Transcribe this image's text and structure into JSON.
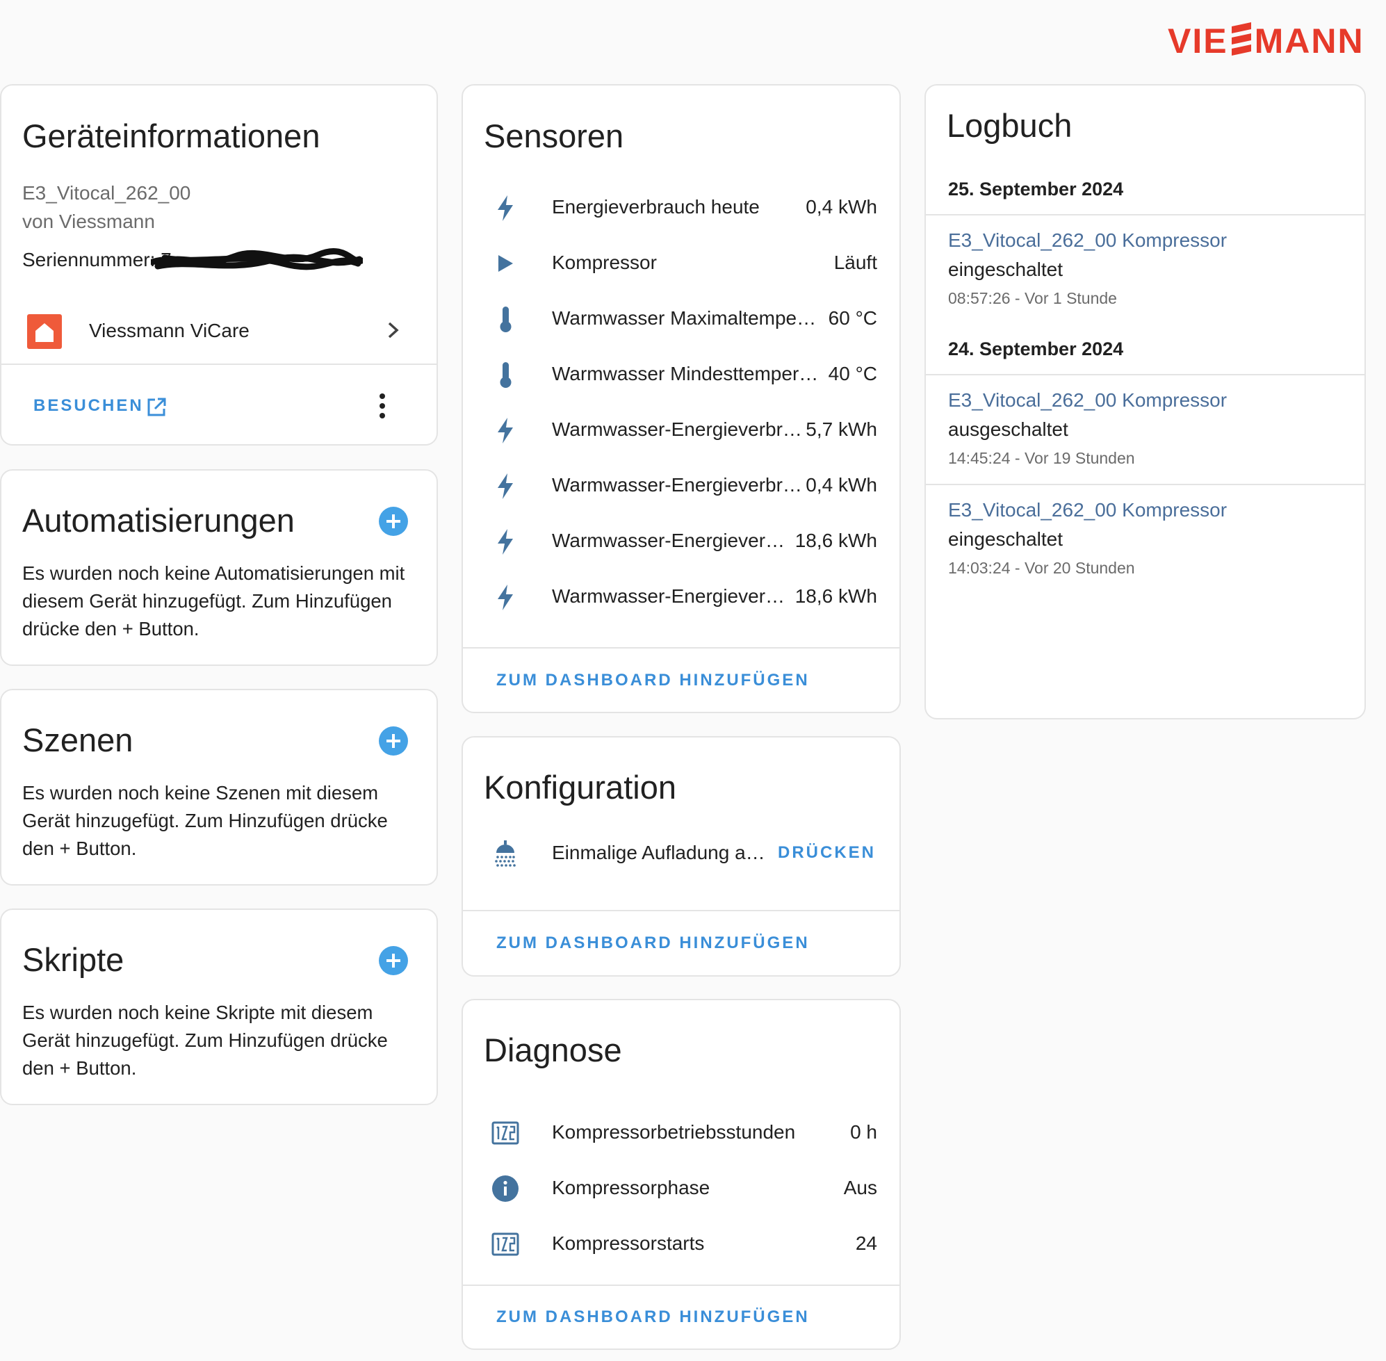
{
  "brand": {
    "logo_text_left": "VIE",
    "logo_text_right": "MANN",
    "color": "#e63a2a"
  },
  "device_info": {
    "title": "Geräteinformationen",
    "model": "E3_Vitocal_262_00",
    "manufacturer": "von Viessmann",
    "serial_label": "Seriennummer: 7",
    "integration": "Viessmann ViCare",
    "visit_button": "BESUCHEN"
  },
  "automations": {
    "title": "Automatisierungen",
    "empty_text": "Es wurden noch keine Automatisierungen mit diesem Gerät hinzugefügt. Zum Hinzufügen drücke den + Button."
  },
  "scenes": {
    "title": "Szenen",
    "empty_text": "Es wurden noch keine Szenen mit diesem Gerät hinzugefügt. Zum Hinzufügen drücke den + Button."
  },
  "scripts": {
    "title": "Skripte",
    "empty_text": "Es wurden noch keine Skripte mit diesem Gerät hinzugefügt. Zum Hinzufügen drücke den + Button."
  },
  "sensors": {
    "title": "Sensoren",
    "rows": [
      {
        "icon": "lightning-bolt-icon",
        "label": "Energieverbrauch heute",
        "value": "0,4 kWh"
      },
      {
        "icon": "play-icon",
        "label": "Kompressor",
        "value": "Läuft"
      },
      {
        "icon": "thermometer-icon",
        "label": "Warmwasser Maximaltempe…",
        "value": "60 °C"
      },
      {
        "icon": "thermometer-icon",
        "label": "Warmwasser Mindesttemper…",
        "value": "40 °C"
      },
      {
        "icon": "lightning-bolt-icon",
        "label": "Warmwasser-Energieverbr…",
        "value": "5,7 kWh"
      },
      {
        "icon": "lightning-bolt-icon",
        "label": "Warmwasser-Energieverbr…",
        "value": "0,4 kWh"
      },
      {
        "icon": "lightning-bolt-icon",
        "label": "Warmwasser-Energiever…",
        "value": "18,6 kWh"
      },
      {
        "icon": "lightning-bolt-icon",
        "label": "Warmwasser-Energiever…",
        "value": "18,6 kWh"
      }
    ],
    "add_button": "ZUM DASHBOARD HINZUFÜGEN"
  },
  "configuration": {
    "title": "Konfiguration",
    "rows": [
      {
        "icon": "shower-icon",
        "label": "Einmalige Aufladung a…",
        "action": "DRÜCKEN"
      }
    ],
    "add_button": "ZUM DASHBOARD HINZUFÜGEN"
  },
  "diagnostics": {
    "title": "Diagnose",
    "rows": [
      {
        "icon": "numeric-icon",
        "label": "Kompressorbetriebsstunden",
        "value": "0 h"
      },
      {
        "icon": "info-icon",
        "label": "Kompressorphase",
        "value": "Aus"
      },
      {
        "icon": "numeric-icon",
        "label": "Kompressorstarts",
        "value": "24"
      }
    ],
    "add_button": "ZUM DASHBOARD HINZUFÜGEN"
  },
  "logbook": {
    "title": "Logbuch",
    "groups": [
      {
        "date": "25. September 2024",
        "entries": [
          {
            "entity": "E3_Vitocal_262_00 Kompressor",
            "message": "eingeschaltet",
            "time": "08:57:26 - Vor 1 Stunde"
          }
        ]
      },
      {
        "date": "24. September 2024",
        "entries": [
          {
            "entity": "E3_Vitocal_262_00 Kompressor",
            "message": "ausgeschaltet",
            "time": "14:45:24 - Vor 19 Stunden"
          },
          {
            "entity": "E3_Vitocal_262_00 Kompressor",
            "message": "eingeschaltet",
            "time": "14:03:24 - Vor 20 Stunden"
          }
        ]
      }
    ]
  },
  "colors": {
    "accent": "#3a8ed8",
    "icon": "#44739e",
    "fab": "#44a2e6",
    "entity_link": "#4a6e9a"
  }
}
